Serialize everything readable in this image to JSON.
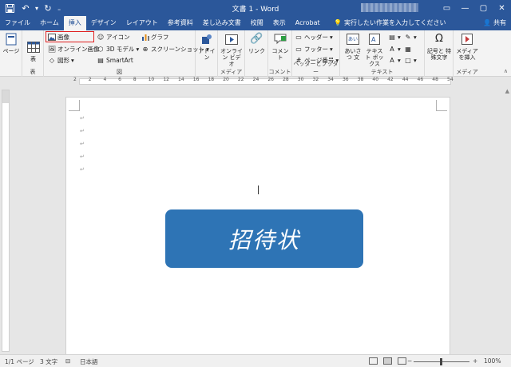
{
  "titlebar": {
    "title": "文書 1 - Word",
    "qat": {
      "save": "save-icon",
      "undo": "undo-icon",
      "redo": "redo-icon",
      "customize": "customize-qat-icon"
    }
  },
  "tabs": [
    "ファイル",
    "ホーム",
    "挿入",
    "デザイン",
    "レイアウト",
    "参考資料",
    "差し込み文書",
    "校閲",
    "表示",
    "Acrobat"
  ],
  "active_tab": "挿入",
  "tellme": {
    "placeholder": "実行したい作業を入力してください"
  },
  "share_label": "共有",
  "ribbon": {
    "pages": {
      "label": "ページ"
    },
    "table": {
      "button": "表",
      "group": "表"
    },
    "illustrations": {
      "picture": "画像",
      "online_picture": "オンライン画像",
      "shapes": "図形",
      "icons": "アイコン",
      "models_3d": "3D モデル",
      "smartart": "SmartArt",
      "chart": "グラフ",
      "screenshot": "スクリーンショット",
      "group": "図"
    },
    "addins": {
      "button": "アドイン"
    },
    "media": {
      "online_video": "オンライン ビデオ",
      "group": "メディア"
    },
    "links": {
      "button": "リンク"
    },
    "comments": {
      "button": "コメント",
      "group": "コメント"
    },
    "header_footer": {
      "header": "ヘッダー",
      "footer": "フッター",
      "page_number": "ページ番号",
      "group": "ヘッダーとフッター"
    },
    "text": {
      "greeting": "あいさつ 文",
      "textbox": "テキスト ボックス",
      "group": "テキスト"
    },
    "symbols": {
      "button": "記号と 特殊文字"
    },
    "media2": {
      "button": "メディア を挿入",
      "group": "メディア"
    }
  },
  "ruler": {
    "numbers": [
      "2",
      "2",
      "4",
      "6",
      "8",
      "10",
      "12",
      "14",
      "16",
      "18",
      "20",
      "22",
      "24",
      "26",
      "28",
      "30",
      "32",
      "34",
      "36",
      "38",
      "40",
      "42",
      "44",
      "46",
      "48",
      "54"
    ]
  },
  "document": {
    "paragraph_mark": "↵",
    "banner_text": "招待状"
  },
  "statusbar": {
    "page": "1/1 ページ",
    "words": "3 文字",
    "language": "日本語",
    "zoom": "100%"
  },
  "colors": {
    "accent": "#2b579a",
    "banner": "#2e74b5",
    "highlight": "#e02020"
  }
}
